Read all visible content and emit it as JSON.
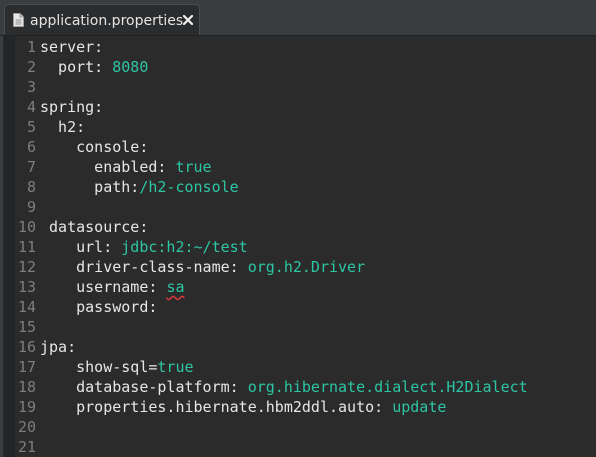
{
  "tab": {
    "title": "application.properties",
    "icon": "file-icon",
    "close_icon": "close-icon"
  },
  "colors": {
    "editor_bg": "#2b2b2b",
    "key": "#e6e6e6",
    "value": "#2dc6a4",
    "line_number": "#7e7e7e",
    "tab_bar": "#3a3d40"
  },
  "editor": {
    "lines": [
      {
        "n": "1",
        "key": "server:",
        "value": ""
      },
      {
        "n": "2",
        "key": "  port: ",
        "value": "8080"
      },
      {
        "n": "3",
        "key": "",
        "value": ""
      },
      {
        "n": "4",
        "key": "spring:",
        "value": ""
      },
      {
        "n": "5",
        "key": "  h2:",
        "value": ""
      },
      {
        "n": "6",
        "key": "    console:",
        "value": ""
      },
      {
        "n": "7",
        "key": "      enabled: ",
        "value": "true"
      },
      {
        "n": "8",
        "key": "      path:",
        "value": "/h2-console"
      },
      {
        "n": "9",
        "key": "",
        "value": ""
      },
      {
        "n": "10",
        "key": " datasource:",
        "value": ""
      },
      {
        "n": "11",
        "key": "    url: ",
        "value": "jdbc:h2:~/test"
      },
      {
        "n": "12",
        "key": "    driver-class-name: ",
        "value": "org.h2.Driver"
      },
      {
        "n": "13",
        "key": "    username: ",
        "value": "sa"
      },
      {
        "n": "14",
        "key": "    password:",
        "value": ""
      },
      {
        "n": "15",
        "key": "",
        "value": ""
      },
      {
        "n": "16",
        "key": "jpa:",
        "value": ""
      },
      {
        "n": "17",
        "key": "    show-sql=",
        "value": "true"
      },
      {
        "n": "18",
        "key": "    database-platform: ",
        "value": "org.hibernate.dialect.H2Dialect"
      },
      {
        "n": "19",
        "key": "    properties.hibernate.hbm2ddl.auto: ",
        "value": "update"
      },
      {
        "n": "20",
        "key": "",
        "value": ""
      },
      {
        "n": "21",
        "key": "",
        "value": ""
      }
    ]
  }
}
